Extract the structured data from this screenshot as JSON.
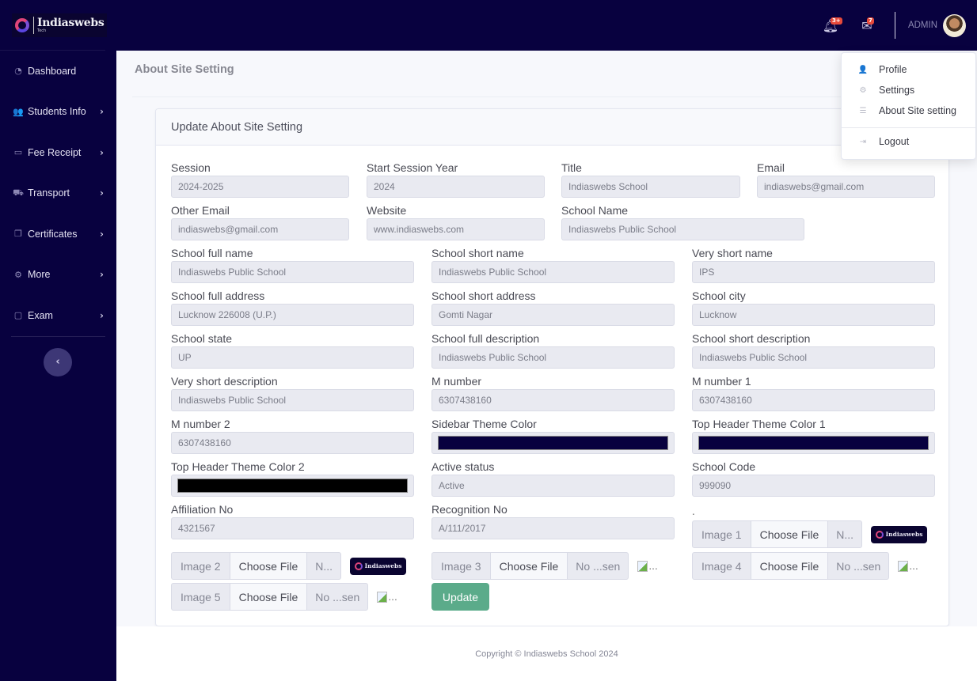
{
  "brand": {
    "name": "Indiaswebs",
    "sub": "Tech"
  },
  "sidebar": {
    "items": [
      {
        "label": "Dashboard",
        "icon": "dashboard-icon",
        "glyph": "◔",
        "has_chevron": false
      },
      {
        "label": "Students Info",
        "icon": "users-icon",
        "glyph": "👥",
        "has_chevron": true
      },
      {
        "label": "Fee Receipt",
        "icon": "money-bill-icon",
        "glyph": "▭",
        "has_chevron": true
      },
      {
        "label": "Transport",
        "icon": "bus-icon",
        "glyph": "⛟",
        "has_chevron": true
      },
      {
        "label": "Certificates",
        "icon": "copy-icon",
        "glyph": "❐",
        "has_chevron": true
      },
      {
        "label": "More",
        "icon": "cog-icon",
        "glyph": "⚙",
        "has_chevron": true
      },
      {
        "label": "Exam",
        "icon": "chalkboard-icon",
        "glyph": "▢",
        "has_chevron": true
      }
    ],
    "chevron": "›",
    "toggle": "‹"
  },
  "topbar": {
    "alerts_badge": "3+",
    "messages_badge": "7",
    "user_label": "ADMIN"
  },
  "dropdown": {
    "items": [
      {
        "label": "Profile",
        "icon": "user-icon",
        "glyph": "👤"
      },
      {
        "label": "Settings",
        "icon": "cogs-icon",
        "glyph": "⚙"
      },
      {
        "label": "About Site setting",
        "icon": "list-icon",
        "glyph": "☰"
      }
    ],
    "logout": {
      "label": "Logout",
      "icon": "sign-out-icon",
      "glyph": "⇥"
    }
  },
  "page": {
    "title": "About Site Setting"
  },
  "card": {
    "title": "Update About Site Setting"
  },
  "form": {
    "session": {
      "label": "Session",
      "value": "2024-2025"
    },
    "start_session_year": {
      "label": "Start Session Year",
      "value": "2024"
    },
    "title": {
      "label": "Title",
      "value": "Indiaswebs School"
    },
    "email": {
      "label": "Email",
      "value": "indiaswebs@gmail.com"
    },
    "other_email": {
      "label": "Other Email",
      "value": "indiaswebs@gmail.com"
    },
    "website": {
      "label": "Website",
      "value": "www.indiaswebs.com"
    },
    "school_name": {
      "label": "School Name",
      "value": "Indiaswebs Public School"
    },
    "school_full_name": {
      "label": "School full name",
      "value": "Indiaswebs Public School"
    },
    "school_short_name": {
      "label": "School short name",
      "value": "Indiaswebs Public School"
    },
    "very_short_name": {
      "label": "Very short name",
      "value": "IPS"
    },
    "school_full_address": {
      "label": "School full address",
      "value": "Lucknow 226008 (U.P.)"
    },
    "school_short_address": {
      "label": "School short address",
      "value": "Gomti Nagar"
    },
    "school_city": {
      "label": "School city",
      "value": "Lucknow"
    },
    "school_state": {
      "label": "School state",
      "value": "UP"
    },
    "school_full_description": {
      "label": "School full description",
      "value": "Indiaswebs Public School"
    },
    "school_short_description": {
      "label": "School short description",
      "value": "Indiaswebs Public School"
    },
    "very_short_description": {
      "label": "Very short description",
      "value": "Indiaswebs Public School"
    },
    "m_number": {
      "label": "M number",
      "value": "6307438160"
    },
    "m_number_1": {
      "label": "M number 1",
      "value": "6307438160"
    },
    "m_number_2": {
      "label": "M number 2",
      "value": "6307438160"
    },
    "sidebar_theme_color": {
      "label": "Sidebar Theme Color",
      "value": "#08013f"
    },
    "top_header_theme_color_1": {
      "label": "Top Header Theme Color 1",
      "value": "#08013f"
    },
    "top_header_theme_color_2": {
      "label": "Top Header Theme Color 2",
      "value": "#000000"
    },
    "active_status": {
      "label": "Active status",
      "value": "Active"
    },
    "school_code": {
      "label": "School Code",
      "value": "999090"
    },
    "affiliation_no": {
      "label": "Affiliation No",
      "value": "4321567"
    },
    "recognition_no": {
      "label": "Recognition No",
      "value": "A/111/2017"
    },
    "dot_label": ".",
    "images": [
      {
        "label": "Image 1",
        "button": "Choose File",
        "filename": "N...",
        "preview": "logo"
      },
      {
        "label": "Image 2",
        "button": "Choose File",
        "filename": "N...",
        "preview": "logo"
      },
      {
        "label": "Image 3",
        "button": "Choose File",
        "filename": "No ...sen",
        "preview": "broken"
      },
      {
        "label": "Image 4",
        "button": "Choose File",
        "filename": "No ...sen",
        "preview": "broken"
      },
      {
        "label": "Image 5",
        "button": "Choose File",
        "filename": "No ...sen",
        "preview": "broken"
      }
    ],
    "preview_broken_text": "...",
    "update_label": "Update"
  },
  "footer": {
    "text": "Copyright © Indiaswebs School 2024"
  },
  "colors": {
    "sidebar_bg": "#08013f",
    "topbar_bg": "#08013f",
    "update_button": "#5bab8a",
    "badge": "#e74a3b"
  }
}
